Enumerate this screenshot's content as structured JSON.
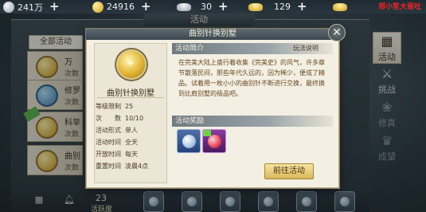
{
  "topbar": {
    "silver_coins": "241万",
    "gold_coins": "24916",
    "silver_ingots": "30",
    "gold_ingots": "129",
    "overlay_text": "郑小笙大哥吐"
  },
  "main": {
    "title": "活动",
    "filter_label": "全部活动",
    "list_items": [
      {
        "name": "万",
        "sub": "次数"
      },
      {
        "name": "修罗",
        "sub": "次数"
      },
      {
        "name": "科举",
        "sub": "次数"
      },
      {
        "name": "曲别",
        "sub": "次数"
      }
    ],
    "right_nav": [
      {
        "label": "活动",
        "icon": "calendar-icon"
      },
      {
        "label": "挑战",
        "icon": "swords-icon"
      },
      {
        "label": "修真",
        "icon": "lotus-icon"
      },
      {
        "label": "成望",
        "icon": "crown-icon"
      }
    ],
    "bottom": {
      "count": "23",
      "count_label": "活跃度"
    }
  },
  "modal": {
    "title": "曲别针换别墅",
    "activity_name": "曲别针换别墅",
    "info": [
      {
        "key": "等级限制",
        "value": "25"
      },
      {
        "key": "次　　数",
        "value": "10/10"
      },
      {
        "key": "活动形式",
        "value": "单人"
      },
      {
        "key": "活动时间",
        "value": "全天"
      },
      {
        "key": "开放时间",
        "value": "每天"
      },
      {
        "key": "重置时间",
        "value": "凌晨4点"
      }
    ],
    "section_intro": "活动简介",
    "rules_link": "玩法说明",
    "description": "在完美大陆上盛行着收集《完美史》的风气，许多章节散落民间，那些年代久远的，因为稀少，便成了精品。试着用一枚小小的曲别针不断进行交换，最终换到比肩别墅的极品吧。",
    "section_reward": "活动奖励",
    "go_button": "前往活动"
  },
  "colors": {
    "panel_bg": "#f3efe3",
    "header_slate": "#5e6b72",
    "button_gold": "#d9b75a",
    "text_brown": "#6a4a22"
  }
}
